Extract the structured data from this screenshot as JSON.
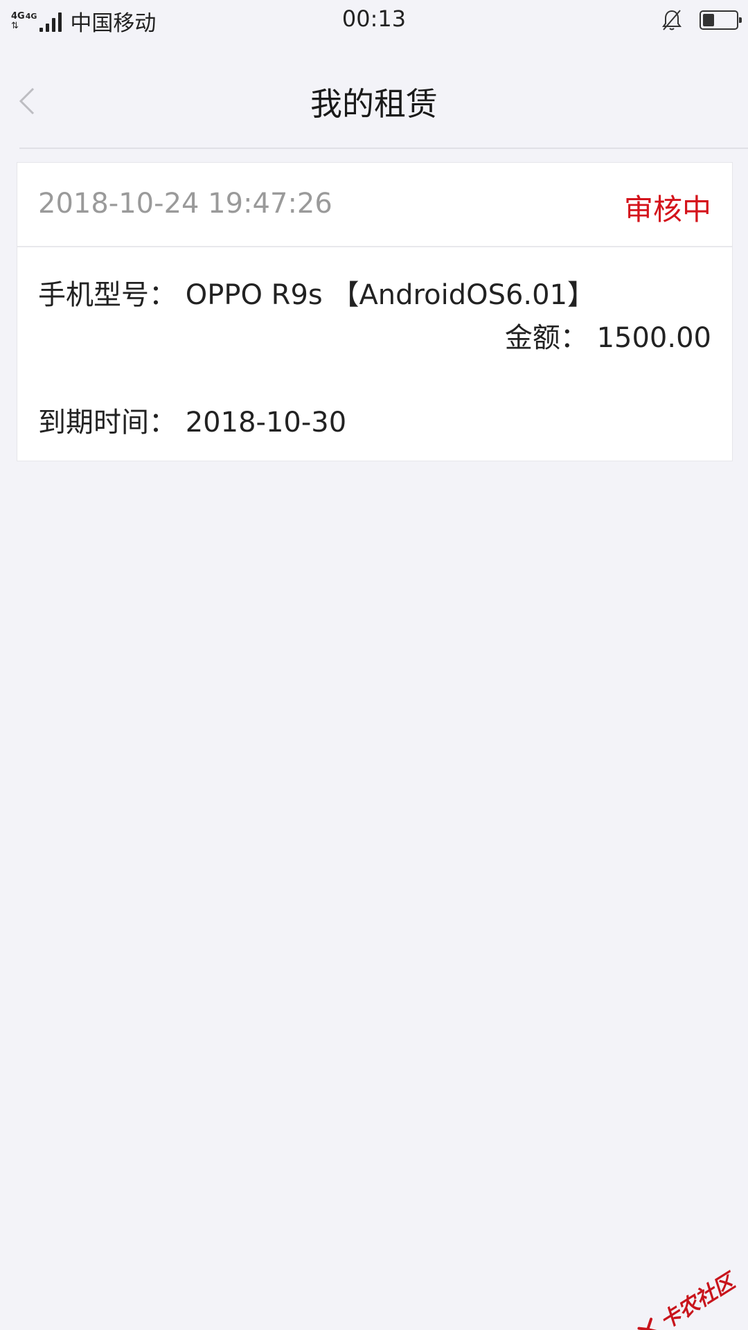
{
  "status_bar": {
    "network": "4G",
    "network2": "4G",
    "carrier": "中国移动",
    "time": "00:13",
    "icons": [
      "signal-icon",
      "mute-bell-icon",
      "battery-icon"
    ],
    "battery_level": 0.35
  },
  "nav": {
    "title": "我的租赁",
    "back_icon": "chevron-left-icon"
  },
  "order": {
    "timestamp": "2018-10-24 19:47:26",
    "status": "审核中",
    "status_color": "#d4141c",
    "model_label": "手机型号：",
    "model_value": "OPPO R9s 【AndroidOS6.01】",
    "amount_label": "金额：",
    "amount_value": "1500.00",
    "due_label": "到期时间：",
    "due_value": "2018-10-30"
  },
  "watermark": {
    "text": "卡农社区"
  }
}
